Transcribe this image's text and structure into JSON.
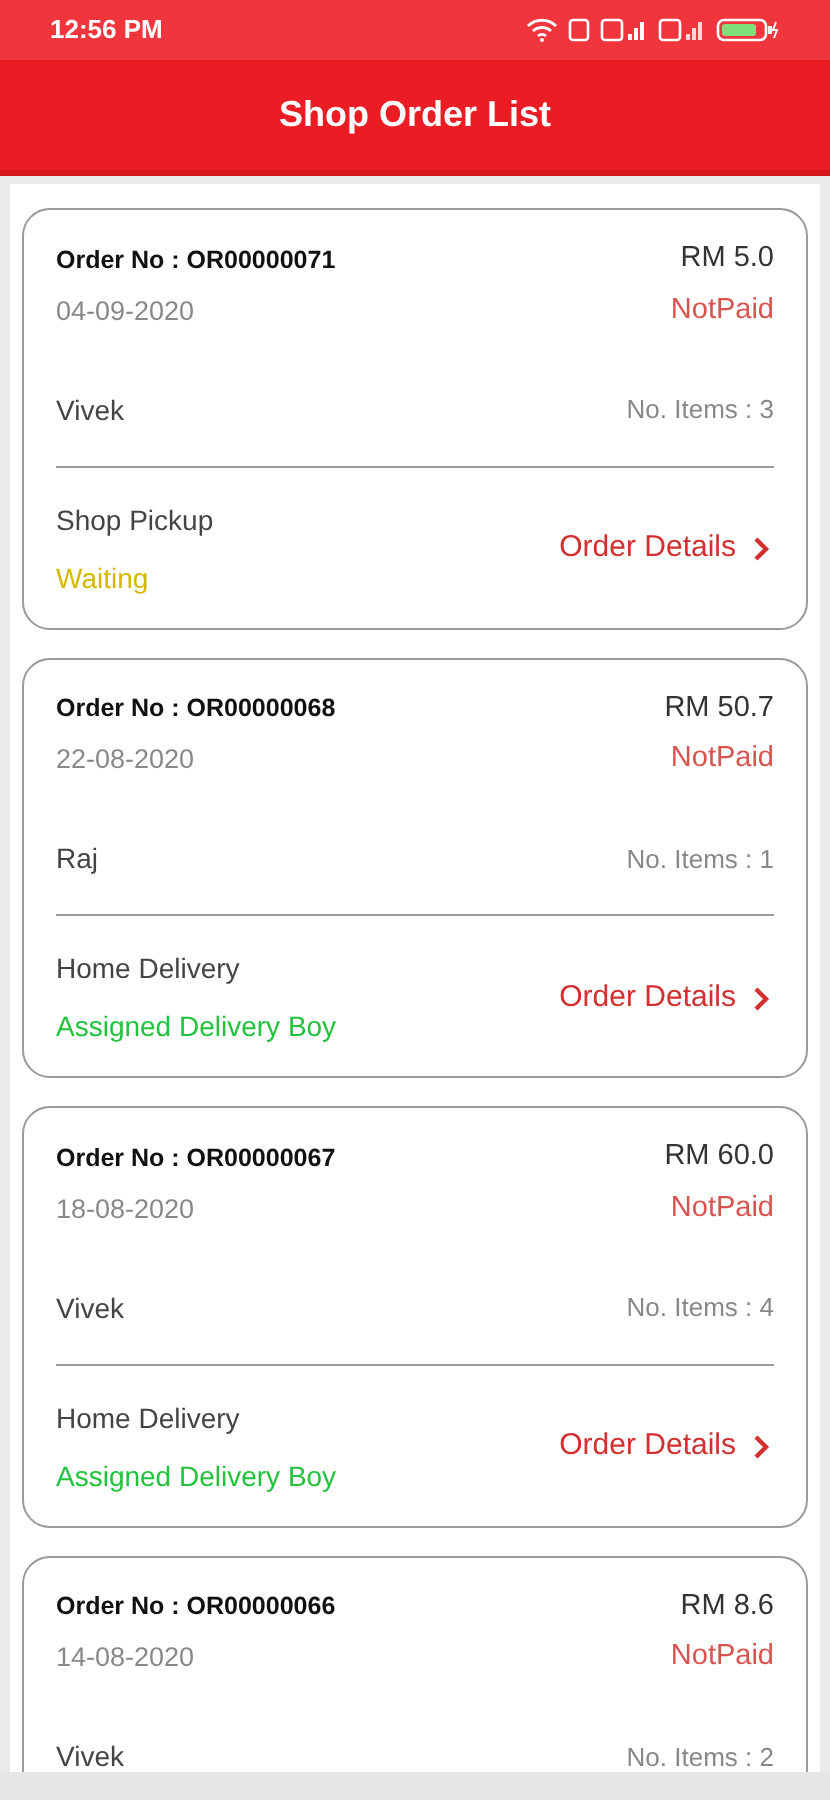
{
  "status_bar": {
    "time": "12:56 PM"
  },
  "header": {
    "title": "Shop Order List"
  },
  "orders": [
    {
      "order_no": "Order No : OR00000071",
      "amount": "RM 5.0",
      "date": "04-09-2020",
      "payment": "NotPaid",
      "customer": "Vivek",
      "items": "No. Items : 3",
      "delivery_type": "Shop Pickup",
      "status": {
        "text": "Waiting",
        "color": "#d4b800"
      },
      "details_link": "Order Details"
    },
    {
      "order_no": "Order No : OR00000068",
      "amount": "RM 50.7",
      "date": "22-08-2020",
      "payment": "NotPaid",
      "customer": "Raj",
      "items": "No. Items : 1",
      "delivery_type": "Home Delivery",
      "status": {
        "text": "Assigned Delivery Boy",
        "color": "#22c33c"
      },
      "details_link": "Order Details"
    },
    {
      "order_no": "Order No : OR00000067",
      "amount": "RM 60.0",
      "date": "18-08-2020",
      "payment": "NotPaid",
      "customer": "Vivek",
      "items": "No. Items : 4",
      "delivery_type": "Home Delivery",
      "status": {
        "text": "Assigned Delivery Boy",
        "color": "#22c33c"
      },
      "details_link": "Order Details"
    },
    {
      "order_no": "Order No : OR00000066",
      "amount": "RM 8.6",
      "date": "14-08-2020",
      "payment": "NotPaid",
      "customer": "Vivek",
      "items": "No. Items : 2"
    }
  ]
}
